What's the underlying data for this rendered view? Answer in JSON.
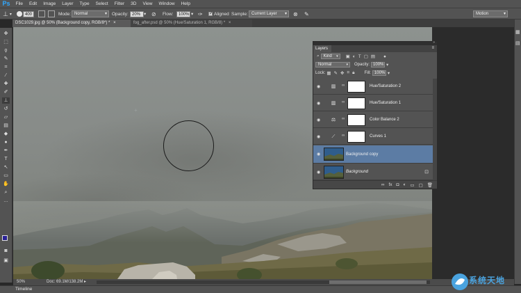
{
  "app": {
    "logo": "Ps"
  },
  "menu": [
    "File",
    "Edit",
    "Image",
    "Layer",
    "Type",
    "Select",
    "Filter",
    "3D",
    "View",
    "Window",
    "Help"
  ],
  "options": {
    "brush_size": "400",
    "mode_label": "Mode:",
    "mode_value": "Normal",
    "opacity_label": "Opacity:",
    "opacity_value": "20%",
    "flow_label": "Flow:",
    "flow_value": "100%",
    "aligned_label": "Aligned",
    "sample_label": "Sample:",
    "sample_value": "Current Layer",
    "workspace_value": "Motion"
  },
  "tabs": [
    {
      "label": "DSC1029.jpg @ 50% (Background copy, RGB/8*) *",
      "active": true
    },
    {
      "label": "fog_after.psd @ 50% (Hue/Saturation 1, RGB/8) *",
      "active": false
    }
  ],
  "status": {
    "zoom": "50%",
    "doc": "Doc: 69.1M/138.2M"
  },
  "timeline": {
    "label": "Timeline"
  },
  "layers_panel": {
    "tab_label": "Layers",
    "filter_value": "Kind",
    "blend_value": "Normal",
    "opacity_label": "Opacity:",
    "opacity_value": "100%",
    "lock_label": "Lock:",
    "fill_label": "Fill:",
    "fill_value": "100%",
    "layers": [
      {
        "name": "Hue/Saturation 2",
        "kind": "adjustment",
        "icon": "hue-saturation-icon"
      },
      {
        "name": "Hue/Saturation 1",
        "kind": "adjustment",
        "icon": "hue-saturation-icon"
      },
      {
        "name": "Color Balance 2",
        "kind": "adjustment",
        "icon": "color-balance-icon"
      },
      {
        "name": "Curves 1",
        "kind": "adjustment",
        "icon": "curves-icon"
      },
      {
        "name": "Background copy",
        "kind": "pixel",
        "selected": true
      },
      {
        "name": "Background",
        "kind": "pixel",
        "locked": true
      }
    ]
  },
  "colors": {
    "foreground": "#2a2196",
    "background": "#ffffff",
    "selection": "#5c7ca4"
  },
  "watermark": {
    "text": "系统天地"
  }
}
